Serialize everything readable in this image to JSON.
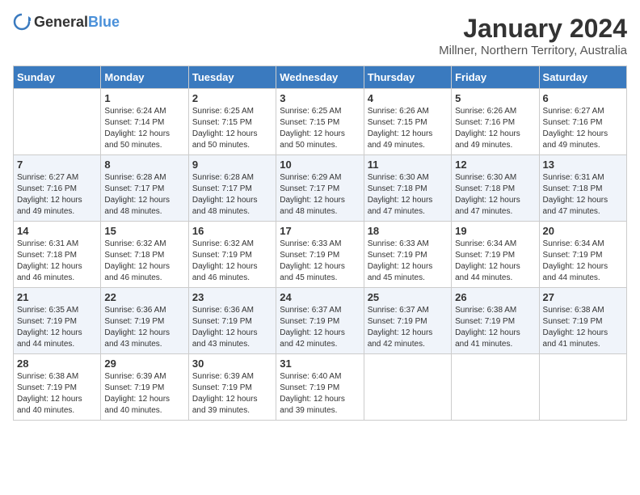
{
  "logo": {
    "general": "General",
    "blue": "Blue"
  },
  "title": "January 2024",
  "subtitle": "Millner, Northern Territory, Australia",
  "days_of_week": [
    "Sunday",
    "Monday",
    "Tuesday",
    "Wednesday",
    "Thursday",
    "Friday",
    "Saturday"
  ],
  "weeks": [
    [
      {
        "day": "",
        "sunrise": "",
        "sunset": "",
        "daylight": ""
      },
      {
        "day": "1",
        "sunrise": "6:24 AM",
        "sunset": "7:14 PM",
        "daylight": "12 hours and 50 minutes."
      },
      {
        "day": "2",
        "sunrise": "6:25 AM",
        "sunset": "7:15 PM",
        "daylight": "12 hours and 50 minutes."
      },
      {
        "day": "3",
        "sunrise": "6:25 AM",
        "sunset": "7:15 PM",
        "daylight": "12 hours and 50 minutes."
      },
      {
        "day": "4",
        "sunrise": "6:26 AM",
        "sunset": "7:15 PM",
        "daylight": "12 hours and 49 minutes."
      },
      {
        "day": "5",
        "sunrise": "6:26 AM",
        "sunset": "7:16 PM",
        "daylight": "12 hours and 49 minutes."
      },
      {
        "day": "6",
        "sunrise": "6:27 AM",
        "sunset": "7:16 PM",
        "daylight": "12 hours and 49 minutes."
      }
    ],
    [
      {
        "day": "7",
        "sunrise": "6:27 AM",
        "sunset": "7:16 PM",
        "daylight": "12 hours and 49 minutes."
      },
      {
        "day": "8",
        "sunrise": "6:28 AM",
        "sunset": "7:17 PM",
        "daylight": "12 hours and 48 minutes."
      },
      {
        "day": "9",
        "sunrise": "6:28 AM",
        "sunset": "7:17 PM",
        "daylight": "12 hours and 48 minutes."
      },
      {
        "day": "10",
        "sunrise": "6:29 AM",
        "sunset": "7:17 PM",
        "daylight": "12 hours and 48 minutes."
      },
      {
        "day": "11",
        "sunrise": "6:30 AM",
        "sunset": "7:18 PM",
        "daylight": "12 hours and 47 minutes."
      },
      {
        "day": "12",
        "sunrise": "6:30 AM",
        "sunset": "7:18 PM",
        "daylight": "12 hours and 47 minutes."
      },
      {
        "day": "13",
        "sunrise": "6:31 AM",
        "sunset": "7:18 PM",
        "daylight": "12 hours and 47 minutes."
      }
    ],
    [
      {
        "day": "14",
        "sunrise": "6:31 AM",
        "sunset": "7:18 PM",
        "daylight": "12 hours and 46 minutes."
      },
      {
        "day": "15",
        "sunrise": "6:32 AM",
        "sunset": "7:18 PM",
        "daylight": "12 hours and 46 minutes."
      },
      {
        "day": "16",
        "sunrise": "6:32 AM",
        "sunset": "7:19 PM",
        "daylight": "12 hours and 46 minutes."
      },
      {
        "day": "17",
        "sunrise": "6:33 AM",
        "sunset": "7:19 PM",
        "daylight": "12 hours and 45 minutes."
      },
      {
        "day": "18",
        "sunrise": "6:33 AM",
        "sunset": "7:19 PM",
        "daylight": "12 hours and 45 minutes."
      },
      {
        "day": "19",
        "sunrise": "6:34 AM",
        "sunset": "7:19 PM",
        "daylight": "12 hours and 44 minutes."
      },
      {
        "day": "20",
        "sunrise": "6:34 AM",
        "sunset": "7:19 PM",
        "daylight": "12 hours and 44 minutes."
      }
    ],
    [
      {
        "day": "21",
        "sunrise": "6:35 AM",
        "sunset": "7:19 PM",
        "daylight": "12 hours and 44 minutes."
      },
      {
        "day": "22",
        "sunrise": "6:36 AM",
        "sunset": "7:19 PM",
        "daylight": "12 hours and 43 minutes."
      },
      {
        "day": "23",
        "sunrise": "6:36 AM",
        "sunset": "7:19 PM",
        "daylight": "12 hours and 43 minutes."
      },
      {
        "day": "24",
        "sunrise": "6:37 AM",
        "sunset": "7:19 PM",
        "daylight": "12 hours and 42 minutes."
      },
      {
        "day": "25",
        "sunrise": "6:37 AM",
        "sunset": "7:19 PM",
        "daylight": "12 hours and 42 minutes."
      },
      {
        "day": "26",
        "sunrise": "6:38 AM",
        "sunset": "7:19 PM",
        "daylight": "12 hours and 41 minutes."
      },
      {
        "day": "27",
        "sunrise": "6:38 AM",
        "sunset": "7:19 PM",
        "daylight": "12 hours and 41 minutes."
      }
    ],
    [
      {
        "day": "28",
        "sunrise": "6:38 AM",
        "sunset": "7:19 PM",
        "daylight": "12 hours and 40 minutes."
      },
      {
        "day": "29",
        "sunrise": "6:39 AM",
        "sunset": "7:19 PM",
        "daylight": "12 hours and 40 minutes."
      },
      {
        "day": "30",
        "sunrise": "6:39 AM",
        "sunset": "7:19 PM",
        "daylight": "12 hours and 39 minutes."
      },
      {
        "day": "31",
        "sunrise": "6:40 AM",
        "sunset": "7:19 PM",
        "daylight": "12 hours and 39 minutes."
      },
      {
        "day": "",
        "sunrise": "",
        "sunset": "",
        "daylight": ""
      },
      {
        "day": "",
        "sunrise": "",
        "sunset": "",
        "daylight": ""
      },
      {
        "day": "",
        "sunrise": "",
        "sunset": "",
        "daylight": ""
      }
    ]
  ],
  "labels": {
    "sunrise": "Sunrise:",
    "sunset": "Sunset:",
    "daylight": "Daylight:"
  }
}
